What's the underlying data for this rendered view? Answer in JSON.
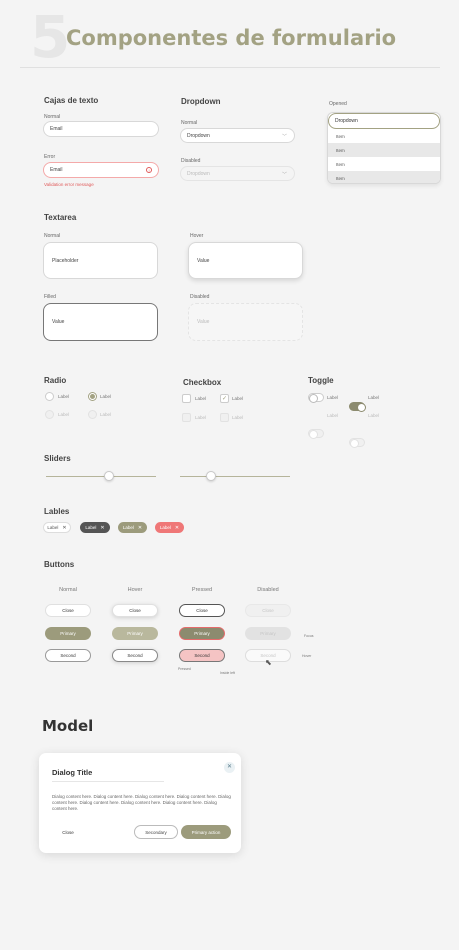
{
  "header": {
    "number": "5",
    "title": "Componentes de formulario"
  },
  "text_inputs": {
    "heading": "Cajas de texto",
    "normal": {
      "label": "Normal",
      "value": "Email"
    },
    "error": {
      "label": "Error",
      "value": "Email",
      "message": "Validation error message"
    }
  },
  "dropdown": {
    "heading": "Dropdown",
    "normal": {
      "label": "Normal",
      "value": "Dropdown"
    },
    "disabled": {
      "label": "Disabled",
      "value": "Dropdown"
    },
    "opened": {
      "label": "Opened",
      "value": "Dropdown",
      "items": [
        "Item",
        "Item",
        "Item",
        "Item"
      ]
    }
  },
  "textarea": {
    "heading": "Textarea",
    "normal": {
      "label": "Normal",
      "value": "Placeholder"
    },
    "hover": {
      "label": "Hover",
      "value": "Value"
    },
    "filled": {
      "label": "Filled",
      "value": "Value"
    },
    "disabled": {
      "label": "Disabled",
      "value": "Value"
    }
  },
  "radio": {
    "heading": "Radio",
    "labels": [
      "Label",
      "Label",
      "Label",
      "Label"
    ]
  },
  "checkbox": {
    "heading": "Checkbox",
    "labels": [
      "Label",
      "Label",
      "Label",
      "Label"
    ],
    "check_mark": "✓"
  },
  "toggle": {
    "heading": "Toggle",
    "labels": [
      "Label",
      "Label",
      "Label",
      "Label"
    ]
  },
  "sliders": {
    "heading": "Sliders",
    "values": [
      0.57,
      0.28
    ]
  },
  "labels_section": {
    "heading": "Lables",
    "chips": [
      "Label",
      "Label",
      "Label",
      "Label"
    ],
    "close": "✕"
  },
  "buttons": {
    "heading": "Buttons",
    "columns": [
      "Normal",
      "Hover",
      "Pressed",
      "Disabled"
    ],
    "close": "Close",
    "primary": "Primary",
    "second": "Second",
    "notes": {
      "focus": "Focus",
      "hover": "Hover",
      "pressed_left": "Pressed",
      "pressed_right": "Inside left"
    }
  },
  "model": {
    "heading": "Model",
    "dialog": {
      "title": "Dialog Title",
      "close_icon": "✕",
      "body": "Dialog content here. Dialog content here. Dialog content here. Dialog content here. Dialog content here. Dialog content here. Dialog content here. Dialog content here. Dialog content here.",
      "close": "Close",
      "secondary": "Secondary",
      "primary": "Primary action"
    }
  },
  "colors": {
    "accent": "#a3a283",
    "accent_dark": "#8c8b6f",
    "error": "#e56b6b",
    "dark_chip": "#555555"
  }
}
